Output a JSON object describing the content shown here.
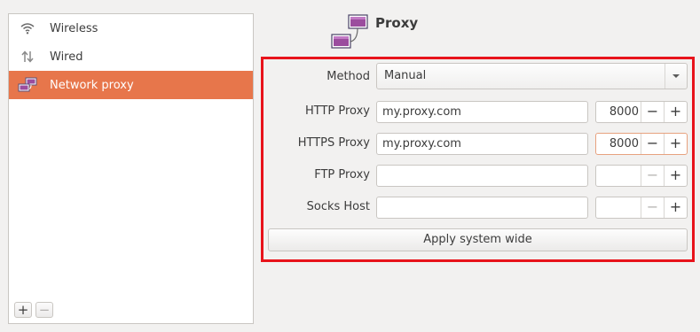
{
  "sidebar": {
    "items": [
      {
        "label": "Wireless",
        "icon": "wifi-icon"
      },
      {
        "label": "Wired",
        "icon": "wired-arrows-icon"
      },
      {
        "label": "Network proxy",
        "icon": "network-proxy-icon",
        "selected": true
      }
    ],
    "add_label": "+",
    "remove_label": "−"
  },
  "header": {
    "title": "Proxy",
    "icon": "network-proxy-icon"
  },
  "form": {
    "method_label": "Method",
    "method_value": "Manual",
    "rows": [
      {
        "label": "HTTP Proxy",
        "host": "my.proxy.com",
        "port": "8000"
      },
      {
        "label": "HTTPS Proxy",
        "host": "my.proxy.com",
        "port": "8000"
      },
      {
        "label": "FTP Proxy",
        "host": "",
        "port": ""
      },
      {
        "label": "Socks Host",
        "host": "",
        "port": ""
      }
    ],
    "minus": "−",
    "plus": "+",
    "apply_label": "Apply system wide"
  },
  "colors": {
    "accent": "#e7764b",
    "highlight_border": "#e8131b"
  }
}
